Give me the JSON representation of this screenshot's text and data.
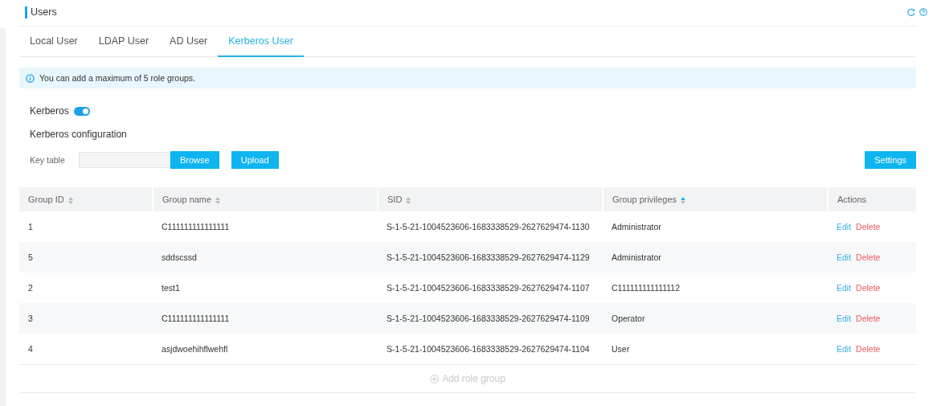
{
  "page": {
    "title": "Users"
  },
  "tabs": [
    {
      "label": "Local User",
      "selected": false
    },
    {
      "label": "LDAP User",
      "selected": false
    },
    {
      "label": "AD User",
      "selected": false
    },
    {
      "label": "Kerberos User",
      "selected": true
    }
  ],
  "notice": "You can add a maximum of 5 role groups.",
  "kerberos": {
    "label": "Kerberos",
    "on": true
  },
  "config": {
    "title": "Kerberos configuration",
    "key_table_label": "Key table",
    "browse": "Browse",
    "upload": "Upload",
    "settings": "Settings"
  },
  "table": {
    "columns": [
      {
        "label": "Group ID",
        "kind": "sortable",
        "sorted": false
      },
      {
        "label": "Group name",
        "kind": "sortable",
        "sorted": false
      },
      {
        "label": "SID",
        "kind": "sortable",
        "sorted": false
      },
      {
        "label": "Group privileges",
        "kind": "sortable",
        "sorted": true
      },
      {
        "label": "Actions",
        "kind": "plain"
      }
    ],
    "rows": [
      {
        "cells": [
          "1",
          "C111111111111111",
          "S-1-5-21-1004523606-1683338529-2627629474-1130",
          "Administrator"
        ],
        "actions": [
          "Edit",
          "Delete"
        ]
      },
      {
        "cells": [
          "5",
          "sddscssd",
          "S-1-5-21-1004523606-1683338529-2627629474-1129",
          "Administrator"
        ],
        "actions": [
          "Edit",
          "Delete"
        ]
      },
      {
        "cells": [
          "2",
          "test1",
          "S-1-5-21-1004523606-1683338529-2627629474-1107",
          "C111111111111112"
        ],
        "actions": [
          "Edit",
          "Delete"
        ]
      },
      {
        "cells": [
          "3",
          "C111111111111111",
          "S-1-5-21-1004523606-1683338529-2627629474-1109",
          "Operator"
        ],
        "actions": [
          "Edit",
          "Delete"
        ]
      },
      {
        "cells": [
          "4",
          "asjdwoehihflwehfl",
          "S-1-5-21-1004523606-1683338529-2627629474-1104",
          "User"
        ],
        "actions": [
          "Edit",
          "Delete"
        ]
      }
    ],
    "add_button": {
      "label": "Add role group",
      "disabled": true
    }
  }
}
